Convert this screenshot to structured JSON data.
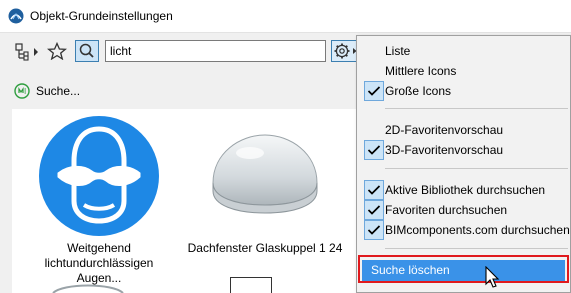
{
  "window": {
    "title": "Objekt-Grundeinstellungen"
  },
  "toolbar": {
    "search_value": "licht",
    "icons": [
      "library-tree-icon",
      "favorites-star-icon",
      "search-icon",
      "settings-gear-icon"
    ]
  },
  "search_bar": {
    "label": "Suche..."
  },
  "items": [
    {
      "label": "Weitgehend lichtundurchlässigen Augen..."
    },
    {
      "label": "Dachfenster Glaskuppel 1 24"
    }
  ],
  "menu": {
    "view_items": [
      {
        "label": "Liste",
        "checked": false
      },
      {
        "label": "Mittlere Icons",
        "checked": false
      },
      {
        "label": "Große Icons",
        "checked": true
      }
    ],
    "preview_items": [
      {
        "label": "2D-Favoritenvorschau",
        "checked": false
      },
      {
        "label": "3D-Favoritenvorschau",
        "checked": true
      }
    ],
    "source_items": [
      {
        "label": "Aktive Bibliothek durchsuchen",
        "checked": true
      },
      {
        "label": "Favoriten durchsuchen",
        "checked": true
      },
      {
        "label": "BIMcomponents.com durchsuchen",
        "checked": true
      }
    ],
    "delete_label": "Suche löschen"
  },
  "colors": {
    "accent": "#3a92e8",
    "highlight_frame": "#e0191d",
    "icon_blue": "#1e88e5",
    "check_bg": "#cce4f7"
  }
}
